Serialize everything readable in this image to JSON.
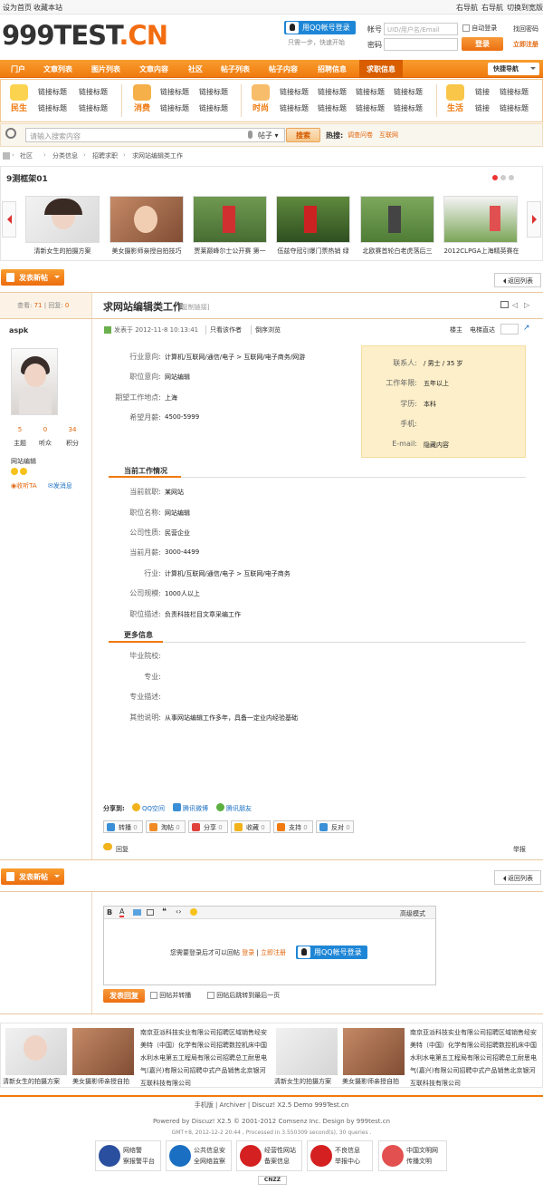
{
  "top": {
    "sethome": "设为首页",
    "bookmark": "收藏本站",
    "nav_right": [
      "右导航",
      "右导航",
      "切换到宽版"
    ]
  },
  "logo": {
    "part1": "999TEST",
    "part2": ".CN"
  },
  "login": {
    "qq_button": "用QQ帐号登录",
    "qq_hint": "只需一步，快速开始",
    "account_label": "帐号",
    "account_placeholder": "UID/用户名/Email",
    "auto_login": "自动登录",
    "forgot": "找回密码",
    "password_label": "密码",
    "login_button": "登录",
    "register": "立即注册"
  },
  "nav": {
    "items": [
      "门户",
      "文章列表",
      "图片列表",
      "文章内容",
      "社区",
      "帖子列表",
      "帖子内容",
      "招聘信息",
      "求职信息"
    ],
    "active_index": 8,
    "quick": "快捷导航"
  },
  "categories": [
    {
      "title": "民生",
      "links": [
        "链接标题",
        "链接标题",
        "链接标题",
        "链接标题"
      ]
    },
    {
      "title": "消费",
      "links": [
        "链接标题",
        "链接标题",
        "链接标题",
        "链接标题"
      ]
    },
    {
      "title": "时尚",
      "links": [
        "链接标题",
        "链接标题",
        "链接标题",
        "链接标题",
        "链接标题",
        "链接标题",
        "链接标题",
        "链接标题"
      ]
    },
    {
      "title": "生活",
      "links": [
        "链接",
        "链接标题",
        "链接",
        "链接标题"
      ]
    }
  ],
  "search": {
    "placeholder": "请输入搜索内容",
    "scope": "帖子",
    "button": "搜索",
    "hot_label": "热搜:",
    "hot": [
      "调查问卷",
      "互联网"
    ]
  },
  "breadcrumb": [
    "社区",
    "分类信息",
    "招聘求职",
    "求网站编辑类工作"
  ],
  "frame": {
    "title": "9测框架01",
    "captions": [
      "清新女生的拍摄方案",
      "美女摄影师亲授自拍技巧",
      "贾莱巅峰尔士公开赛 第一",
      "伍兹夺冠引爆门票热销 绿",
      "北欧赛首轮白老虎落后三",
      "2012CLPGA上海精英赛在"
    ]
  },
  "post_button": "发表新帖",
  "back_button": "返回列表",
  "thread": {
    "views_label": "查看:",
    "views": "71",
    "replies_label": "回复:",
    "replies": "0",
    "title": "求网站编辑类工作",
    "copy_link": "[复制链接]"
  },
  "author": {
    "name": "aspk",
    "stats": [
      {
        "value": "5",
        "label": "主题"
      },
      {
        "value": "0",
        "label": "听众"
      },
      {
        "value": "34",
        "label": "积分"
      }
    ],
    "group": "网站编辑",
    "follow": "收听TA",
    "message": "发消息"
  },
  "postmeta": {
    "posted": "发表于 2012-11-8 10:13:41",
    "only_author": "只看该作者",
    "reverse": "倒序浏览",
    "owner": "楼主",
    "jump": "电梯直达"
  },
  "fields": [
    {
      "label": "行业意向:",
      "value": "计算机/互联网/通信/电子 > 互联网/电子商务/网游"
    },
    {
      "label": "职位意向:",
      "value": "网站编辑"
    },
    {
      "label": "期望工作地点:",
      "value": "上海"
    },
    {
      "label": "希望月薪:",
      "value": "4500-5999"
    }
  ],
  "profile": [
    {
      "label": "联系人:",
      "value": "/ 男士 / 35 岁"
    },
    {
      "label": "工作年限:",
      "value": "五年以上"
    },
    {
      "label": "学历:",
      "value": "本科"
    },
    {
      "label": "手机:",
      "value": ""
    },
    {
      "label": "E-mail:",
      "value": "隐藏内容"
    }
  ],
  "current": {
    "title": "当前工作情况",
    "rows": [
      {
        "label": "当前就职:",
        "value": "某网站"
      },
      {
        "label": "职位名称:",
        "value": "网站编辑"
      },
      {
        "label": "公司性质:",
        "value": "民营企业"
      },
      {
        "label": "当前月薪:",
        "value": "3000-4499"
      },
      {
        "label": "行业:",
        "value": "计算机/互联网/通信/电子 > 互联网/电子商务"
      },
      {
        "label": "公司规模:",
        "value": "1000人以上"
      },
      {
        "label": "职位描述:",
        "value": "负责科技栏目文章采编工作"
      }
    ]
  },
  "more": {
    "title": "更多信息",
    "rows": [
      {
        "label": "毕业院校:",
        "value": ""
      },
      {
        "label": "专业:",
        "value": ""
      },
      {
        "label": "专业描述:",
        "value": ""
      },
      {
        "label": "其他说明:",
        "value": "从事网站编辑工作多年，具备一定业内经验基础"
      }
    ]
  },
  "share": {
    "label": "分享到:",
    "items": [
      "QQ空间",
      "腾讯微博",
      "腾讯朋友"
    ]
  },
  "actions": [
    {
      "label": "转播",
      "count": "0",
      "color": "#3a8fd6"
    },
    {
      "label": "淘帖",
      "count": "0",
      "color": "#f08a24"
    },
    {
      "label": "分享",
      "count": "0",
      "color": "#e0413a"
    },
    {
      "label": "收藏",
      "count": "0",
      "color": "#f2b21b"
    },
    {
      "label": "支持",
      "count": "0",
      "color": "#f07a10"
    },
    {
      "label": "反对",
      "count": "0",
      "color": "#3a8fd6"
    }
  ],
  "reply_link": "回复",
  "report": "举报",
  "editor": {
    "advanced": "高级模式",
    "login_notice": "您需要登录后才可以回帖",
    "login": "登录",
    "register": "立即注册",
    "qq_button": "用QQ帐号登录",
    "submit": "发表回复",
    "opt1": "回帖并转播",
    "opt2": "回帖后跳转到最后一页"
  },
  "bottom": {
    "captions": [
      "清新女生的拍摄方案",
      "美女摄影师亲授自拍",
      "清新女生的拍摄方案",
      "美女摄影师亲授自拍"
    ],
    "text": "南京亚派科技实业有限公司招聘区域销售经安美特（中国）化学有限公司招聘数控机床中国水利水电第五工程局有限公司招聘总工耐思电气(嘉兴)有限公司招聘中式产品销售北京银河互联科技有限公司"
  },
  "footer": {
    "links": [
      "手机版",
      "Archiver",
      "Discuz! X2.5 Demo 999Test.cn"
    ],
    "powered": "Powered by Discuz! X2.5 © 2001-2012 Comsenz Inc. Design by 999test.cn",
    "gmt": "GMT+8, 2012-12-2 20:44 , Processed in 3.550309 second(s), 30 queries .",
    "badges": [
      {
        "l1": "网络警",
        "l2": "察报警平台",
        "color": "#2a4f9e"
      },
      {
        "l1": "公共信息安",
        "l2": "全网络监察",
        "color": "#1a6fc2"
      },
      {
        "l1": "经营性网站",
        "l2": "备案信息",
        "color": "#d42020"
      },
      {
        "l1": "不良信息",
        "l2": "举报中心",
        "color": "#d42020"
      },
      {
        "l1": "中国文明网",
        "l2": "传播文明",
        "color": "#e35050"
      }
    ],
    "cnzz": "CNZZ"
  }
}
